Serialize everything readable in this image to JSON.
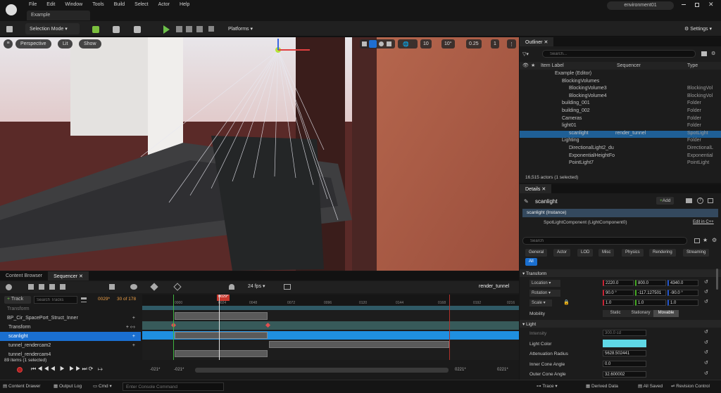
{
  "menu": [
    "File",
    "Edit",
    "Window",
    "Tools",
    "Build",
    "Select",
    "Actor",
    "Help"
  ],
  "project_tab": "Example",
  "window_title": "environment01",
  "toolbar": {
    "mode": "Selection Mode",
    "platforms": "Platforms",
    "settings": "Settings"
  },
  "viewport": {
    "perspective": "Perspective",
    "lit": "Lit",
    "show": "Show",
    "grid": "10",
    "angle": "10°",
    "scale": "0.25",
    "cams": "1"
  },
  "panels": {
    "content_browser": "Content Browser",
    "sequencer": "Sequencer"
  },
  "sequencer": {
    "track_btn": "Track",
    "search_placeholder": "Search Tracks",
    "frame": "0029*",
    "count": "30 of 178",
    "fps": "24 fps",
    "name": "render_tunnel",
    "current": "0029*",
    "ticks": [
      "0000",
      "0024",
      "0048",
      "0072",
      "0096",
      "0120",
      "0144",
      "0168",
      "0192",
      "0216"
    ],
    "tracks": [
      "Transform",
      "BP_Cir_SpacePort_Struct_Inner",
      "Transform",
      "scanlight",
      "tunnel_rendercam2",
      "tunnel_rendercam4"
    ],
    "selection": "89 items (1 selected)",
    "range": [
      "-021*",
      "-021*",
      "0221*",
      "0221*"
    ]
  },
  "outliner": {
    "title": "Outliner",
    "search": "Search...",
    "headers": [
      "Item Label",
      "Sequencer",
      "Type"
    ],
    "rows": [
      {
        "name": "Example (Editor)",
        "seq": "",
        "type": "",
        "indent": 0
      },
      {
        "name": "BlockingVolumes",
        "seq": "",
        "type": "",
        "indent": 1
      },
      {
        "name": "BlockingVolume3",
        "seq": "",
        "type": "BlockingVol",
        "indent": 2
      },
      {
        "name": "BlockingVolume4",
        "seq": "",
        "type": "BlockingVol",
        "indent": 2
      },
      {
        "name": "building_001",
        "seq": "",
        "type": "Folder",
        "indent": 1
      },
      {
        "name": "building_002",
        "seq": "",
        "type": "Folder",
        "indent": 1
      },
      {
        "name": "Cameras",
        "seq": "",
        "type": "Folder",
        "indent": 1
      },
      {
        "name": "light01",
        "seq": "",
        "type": "Folder",
        "indent": 1
      },
      {
        "name": "scanlight",
        "seq": "render_tunnel",
        "type": "SpotLight",
        "indent": 2
      },
      {
        "name": "Lighting",
        "seq": "",
        "type": "Folder",
        "indent": 1
      },
      {
        "name": "DirectionalLight2_du",
        "seq": "",
        "type": "DirectionalL",
        "indent": 2
      },
      {
        "name": "ExponentialHeightFo",
        "seq": "",
        "type": "Exponential",
        "indent": 2
      },
      {
        "name": "PointLight7",
        "seq": "",
        "type": "PointLight",
        "indent": 2
      }
    ],
    "count": "16,515 actors (1 selected)"
  },
  "details": {
    "title": "Details",
    "actor": "scanlight",
    "add": "Add",
    "instance": "scanlight (Instance)",
    "component": "SpotLightComponent (LightComponent0)",
    "edit_cpp": "Edit in C++",
    "search": "Search",
    "categories": [
      "General",
      "Actor",
      "LOD",
      "Misc",
      "Physics",
      "Rendering",
      "Streaming",
      "All"
    ],
    "transform_header": "Transform",
    "location": {
      "label": "Location",
      "x": "2220.0",
      "y": "800.0",
      "z": "4340.0"
    },
    "rotation": {
      "label": "Rotation",
      "x": "90.0 °",
      "y": "-117.127501",
      "z": "-90.0 °"
    },
    "scale": {
      "label": "Scale",
      "x": "1.0",
      "y": "1.0",
      "z": "1.0"
    },
    "mobility": {
      "label": "Mobility",
      "options": [
        "Static",
        "Stationary",
        "Movable"
      ]
    },
    "light_header": "Light",
    "intensity": {
      "label": "Intensity",
      "value": "300.0 cd"
    },
    "light_color": {
      "label": "Light Color"
    },
    "attenuation": {
      "label": "Attenuation Radius",
      "value": "5628.502441"
    },
    "inner_cone": {
      "label": "Inner Cone Angle",
      "value": "0.0"
    },
    "outer_cone": {
      "label": "Outer Cone Angle",
      "value": "32.600002"
    }
  },
  "statusbar": {
    "content_drawer": "Content Drawer",
    "output_log": "Output Log",
    "cmd": "Cmd",
    "console_placeholder": "Enter Console Command",
    "trace": "Trace",
    "derived": "Derived Data",
    "saved": "All Saved",
    "revision": "Revision Control"
  },
  "colors": {
    "accent": "#0070e0",
    "light_color": "#5fd8e6",
    "selected_row": "#1f5f96"
  }
}
